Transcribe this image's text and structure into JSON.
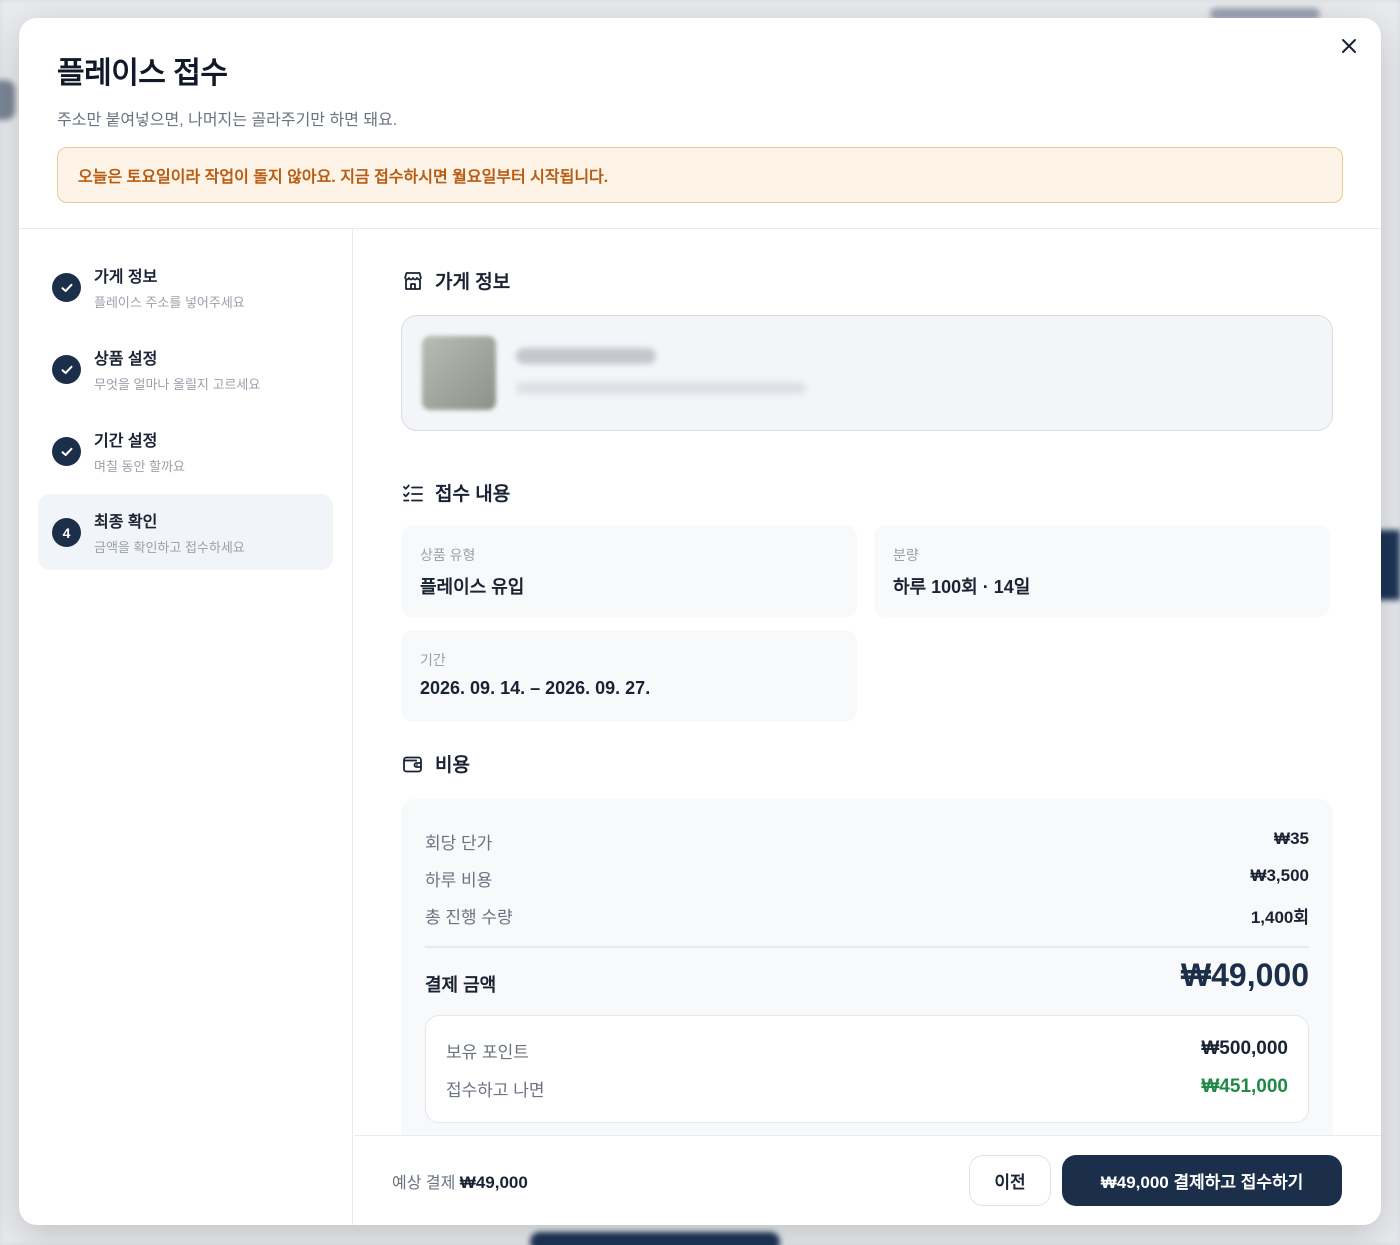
{
  "dialog": {
    "title": "플레이스 접수",
    "subtitle": "주소만 붙여넣으면, 나머지는 골라주기만 하면 돼요.",
    "notice": "오늘은 토요일이라 작업이 돌지 않아요. 지금 접수하시면 월요일부터 시작됩니다."
  },
  "steps": [
    {
      "title": "가게 정보",
      "desc": "플레이스 주소를 넣어주세요",
      "status": "done"
    },
    {
      "title": "상품 설정",
      "desc": "무엇을 얼마나 올릴지 고르세요",
      "status": "done"
    },
    {
      "title": "기간 설정",
      "desc": "며칠 동안 할까요",
      "status": "done"
    },
    {
      "number": "4",
      "title": "최종 확인",
      "desc": "금액을 확인하고 접수하세요",
      "status": "active"
    }
  ],
  "store_section": {
    "title": "가게 정보"
  },
  "summary_section": {
    "title": "접수 내용",
    "product_type": {
      "label": "상품 유형",
      "value": "플레이스 유입"
    },
    "quantity": {
      "label": "분량",
      "value": "하루 100회 · 14일"
    },
    "period": {
      "label": "기간",
      "value": "2026. 09. 14. – 2026. 09. 27."
    }
  },
  "cost_section": {
    "title": "비용",
    "unit_price": {
      "label": "회당 단가",
      "value": "₩35"
    },
    "daily_cost": {
      "label": "하루 비용",
      "value": "₩3,500"
    },
    "total_count": {
      "label": "총 진행 수량",
      "value": "1,400회"
    },
    "total": {
      "label": "결제 금액",
      "value": "₩49,000"
    },
    "points": {
      "owned": {
        "label": "보유 포인트",
        "value": "₩500,000"
      },
      "after": {
        "label": "접수하고 나면",
        "value": "₩451,000"
      }
    }
  },
  "footer": {
    "estimate_label": "예상 결제",
    "estimate_value": "₩49,000",
    "prev_label": "이전",
    "submit_label": "₩49,000 결제하고 접수하기"
  },
  "colors": {
    "primary": "#1b2f4b",
    "notice_bg": "#fdf3e7",
    "notice_text": "#b85c12",
    "positive": "#1f8a45"
  }
}
